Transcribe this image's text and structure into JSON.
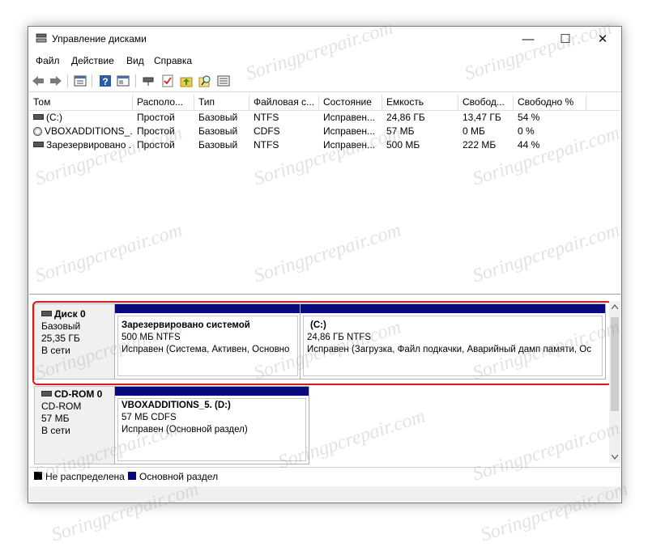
{
  "window": {
    "title": "Управление дисками",
    "controls": {
      "minimize": "—",
      "maximize": "☐",
      "close": "✕"
    }
  },
  "menu": [
    "Файл",
    "Действие",
    "Вид",
    "Справка"
  ],
  "toolbar_icons": [
    "back-arrow-icon",
    "forward-arrow-icon",
    "properties-icon",
    "help-icon",
    "show-hide-icon",
    "connect-disk-icon",
    "check-icon",
    "folder-up-icon",
    "search-icon",
    "list-view-icon"
  ],
  "volumes": {
    "columns": [
      "Том",
      "Располо...",
      "Тип",
      "Файловая с...",
      "Состояние",
      "Емкость",
      "Свобод...",
      "Свободно %"
    ],
    "rows": [
      {
        "name": "(C:)",
        "layout": "Простой",
        "type": "Базовый",
        "fs": "NTFS",
        "status": "Исправен...",
        "capacity": "24,86 ГБ",
        "free": "13,47 ГБ",
        "free_pct": "54 %"
      },
      {
        "name": "VBOXADDITIONS_...",
        "layout": "Простой",
        "type": "Базовый",
        "fs": "CDFS",
        "status": "Исправен...",
        "capacity": "57 МБ",
        "free": "0 МБ",
        "free_pct": "0 %"
      },
      {
        "name": "Зарезервировано ...",
        "layout": "Простой",
        "type": "Базовый",
        "fs": "NTFS",
        "status": "Исправен...",
        "capacity": "500 МБ",
        "free": "222 МБ",
        "free_pct": "44 %"
      }
    ]
  },
  "disks": [
    {
      "name": "Диск 0",
      "kind": "Базовый",
      "size": "25,35 ГБ",
      "state": "В сети",
      "partitions": [
        {
          "title": "Зарезервировано системой",
          "size": "500 МБ NTFS",
          "status": "Исправен (Система, Активен, Основно"
        },
        {
          "title": "(C:)",
          "size": "24,86 ГБ NTFS",
          "status": "Исправен (Загрузка, Файл подкачки, Аварийный дамп памяти, Ос"
        }
      ]
    },
    {
      "name": "CD-ROM 0",
      "kind": "CD-ROM",
      "size": "57 МБ",
      "state": "В сети",
      "partitions": [
        {
          "title": "VBOXADDITIONS_5.  (D:)",
          "size": "57 МБ CDFS",
          "status": "Исправен (Основной раздел)"
        }
      ]
    }
  ],
  "legend": {
    "unallocated": "Не распределена",
    "primary": "Основной раздел"
  },
  "colors": {
    "partition_bar": "#0a0a7a",
    "unallocated": "#000000",
    "highlight": "#e0161b"
  },
  "watermark": "Soringpcrepair.com"
}
